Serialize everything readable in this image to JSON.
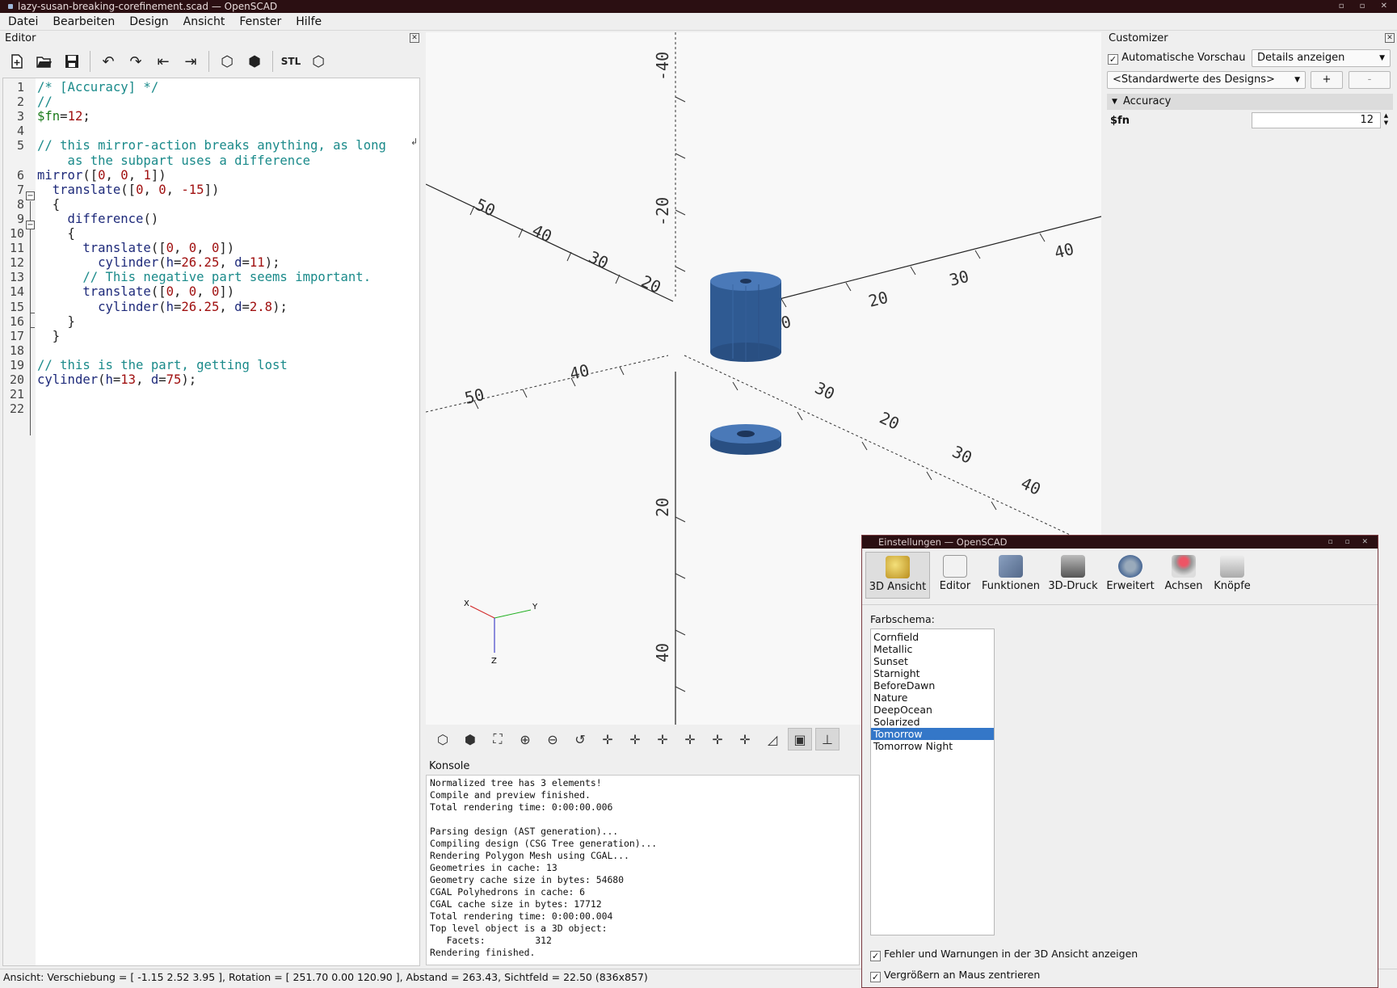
{
  "window": {
    "title": "lazy-susan-breaking-corefinement.scad — OpenSCAD"
  },
  "menu": [
    "Datei",
    "Bearbeiten",
    "Design",
    "Ansicht",
    "Fenster",
    "Hilfe"
  ],
  "editor": {
    "title": "Editor",
    "toolbar_icons": [
      "new-file-icon",
      "open-file-icon",
      "save-icon",
      "undo-icon",
      "redo-icon",
      "unindent-icon",
      "indent-icon",
      "preview-icon",
      "render-icon",
      "export-stl-icon",
      "send-to-print-icon"
    ],
    "stl_label": "STL",
    "line_numbers": [
      "1",
      "2",
      "3",
      "4",
      "5",
      "",
      "6",
      "7",
      "8",
      "9",
      "10",
      "11",
      "12",
      "13",
      "14",
      "15",
      "16",
      "17",
      "18",
      "19",
      "20",
      "21",
      "22"
    ],
    "lines": [
      [
        [
          "cm",
          "/* [Accuracy] */"
        ]
      ],
      [
        [
          "cm",
          "//"
        ]
      ],
      [
        [
          "var",
          "$fn"
        ],
        [
          "pl",
          "="
        ],
        [
          "num",
          "12"
        ],
        [
          "pl",
          ";"
        ]
      ],
      [
        [
          "pl",
          ""
        ]
      ],
      [
        [
          "cm",
          "// this mirror-action breaks anything, as long"
        ]
      ],
      [
        [
          "cm",
          "    as the subpart uses a difference"
        ]
      ],
      [
        [
          "kw",
          "mirror"
        ],
        [
          "pl",
          "(["
        ],
        [
          "num",
          "0"
        ],
        [
          "pl",
          ", "
        ],
        [
          "num",
          "0"
        ],
        [
          "pl",
          ", "
        ],
        [
          "num",
          "1"
        ],
        [
          "pl",
          "])"
        ]
      ],
      [
        [
          "kw",
          "  translate"
        ],
        [
          "pl",
          "(["
        ],
        [
          "num",
          "0"
        ],
        [
          "pl",
          ", "
        ],
        [
          "num",
          "0"
        ],
        [
          "pl",
          ", "
        ],
        [
          "num",
          "-15"
        ],
        [
          "pl",
          "])"
        ]
      ],
      [
        [
          "pl",
          "  {"
        ]
      ],
      [
        [
          "kw",
          "    difference"
        ],
        [
          "pl",
          "()"
        ]
      ],
      [
        [
          "pl",
          "    {"
        ]
      ],
      [
        [
          "kw",
          "      translate"
        ],
        [
          "pl",
          "(["
        ],
        [
          "num",
          "0"
        ],
        [
          "pl",
          ", "
        ],
        [
          "num",
          "0"
        ],
        [
          "pl",
          ", "
        ],
        [
          "num",
          "0"
        ],
        [
          "pl",
          "])"
        ]
      ],
      [
        [
          "kw",
          "        cylinder"
        ],
        [
          "pl",
          "("
        ],
        [
          "kw",
          "h"
        ],
        [
          "pl",
          "="
        ],
        [
          "num",
          "26.25"
        ],
        [
          "pl",
          ", "
        ],
        [
          "kw",
          "d"
        ],
        [
          "pl",
          "="
        ],
        [
          "num",
          "11"
        ],
        [
          "pl",
          ");"
        ]
      ],
      [
        [
          "cm",
          "      // This negative part seems important."
        ]
      ],
      [
        [
          "kw",
          "      translate"
        ],
        [
          "pl",
          "(["
        ],
        [
          "num",
          "0"
        ],
        [
          "pl",
          ", "
        ],
        [
          "num",
          "0"
        ],
        [
          "pl",
          ", "
        ],
        [
          "num",
          "0"
        ],
        [
          "pl",
          "])"
        ]
      ],
      [
        [
          "kw",
          "        cylinder"
        ],
        [
          "pl",
          "("
        ],
        [
          "kw",
          "h"
        ],
        [
          "pl",
          "="
        ],
        [
          "num",
          "26.25"
        ],
        [
          "pl",
          ", "
        ],
        [
          "kw",
          "d"
        ],
        [
          "pl",
          "="
        ],
        [
          "num",
          "2.8"
        ],
        [
          "pl",
          ");"
        ]
      ],
      [
        [
          "pl",
          "    }"
        ]
      ],
      [
        [
          "pl",
          "  }"
        ]
      ],
      [
        [
          "pl",
          ""
        ]
      ],
      [
        [
          "cm",
          "// this is the part, getting lost"
        ]
      ],
      [
        [
          "kw",
          "cylinder"
        ],
        [
          "pl",
          "("
        ],
        [
          "kw",
          "h"
        ],
        [
          "pl",
          "="
        ],
        [
          "num",
          "13"
        ],
        [
          "pl",
          ", "
        ],
        [
          "kw",
          "d"
        ],
        [
          "pl",
          "="
        ],
        [
          "num",
          "75"
        ],
        [
          "pl",
          ");"
        ]
      ],
      [
        [
          "pl",
          ""
        ]
      ],
      [
        [
          "pl",
          ""
        ]
      ]
    ]
  },
  "viewport": {
    "axis_labels": {
      "x": "X",
      "y": "Y",
      "z": "Z"
    },
    "ruler_labels": [
      "-40",
      "-20",
      "20",
      "40",
      "50",
      "40",
      "30",
      "20",
      "10",
      "20",
      "30",
      "40",
      "50",
      "40",
      "30",
      "20",
      "30",
      "40",
      "50"
    ]
  },
  "view_toolbar_icons": [
    "preview-icon",
    "render-icon",
    "zoom-all-icon",
    "zoom-in-icon",
    "zoom-out-icon",
    "reset-view-icon",
    "view-right-icon",
    "view-top-icon",
    "view-bottom-icon",
    "view-left-icon",
    "view-front-icon",
    "view-back-icon",
    "perspective-icon",
    "orthogonal-icon",
    "show-axes-icon"
  ],
  "console": {
    "title": "Konsole",
    "lines": [
      "Normalized tree has 3 elements!",
      "Compile and preview finished.",
      "Total rendering time: 0:00:00.006",
      "",
      "Parsing design (AST generation)...",
      "Compiling design (CSG Tree generation)...",
      "Rendering Polygon Mesh using CGAL...",
      "Geometries in cache: 13",
      "Geometry cache size in bytes: 54680",
      "CGAL Polyhedrons in cache: 6",
      "CGAL cache size in bytes: 17712",
      "Total rendering time: 0:00:00.004",
      "Top level object is a 3D object:",
      "   Facets:         312",
      "Rendering finished."
    ]
  },
  "status": "Ansicht: Verschiebung = [ -1.15 2.52 3.95 ], Rotation = [ 251.70 0.00 120.90 ], Abstand = 263.43, Sichtfeld = 22.50 (836x857)",
  "customizer": {
    "title": "Customizer",
    "auto_preview_label": "Automatische Vorschau",
    "details_combo": "Details anzeigen",
    "preset_combo": "<Standardwerte des Designs>",
    "add_label": "+",
    "remove_label": "-",
    "group": "Accuracy",
    "param_name": "$fn",
    "param_value": "12"
  },
  "prefs": {
    "title": "Einstellungen — OpenSCAD",
    "tabs": [
      "3D Ansicht",
      "Editor",
      "Funktionen",
      "3D-Druck",
      "Erweitert",
      "Achsen",
      "Knöpfe"
    ],
    "color_scheme_label": "Farbschema:",
    "color_schemes": [
      "Cornfield",
      "Metallic",
      "Sunset",
      "Starnight",
      "BeforeDawn",
      "Nature",
      "DeepOcean",
      "Solarized",
      "Tomorrow",
      "Tomorrow Night"
    ],
    "selected_scheme": "Tomorrow",
    "check1": "Fehler und Warnungen in der 3D Ansicht anzeigen",
    "check2": "Vergrößern an Maus zentrieren"
  }
}
